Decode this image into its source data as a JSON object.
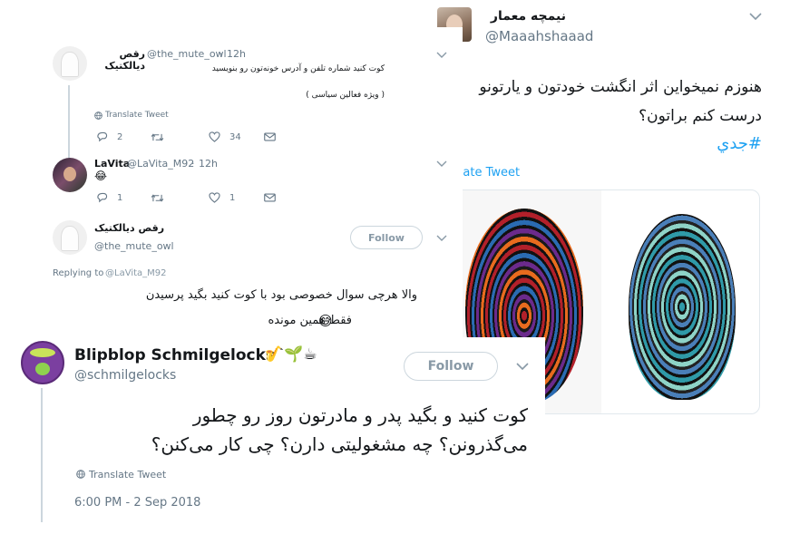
{
  "right_tweet": {
    "display_name": "نیمچه معمار",
    "handle": "@Maaahshaaad",
    "text_line1": "هنوزم نمیخواین اثر انگشت خودتون و یارتونو",
    "text_line2": "درست کنم براتون؟",
    "hashtag": "#جدي",
    "translate": "slate Tweet"
  },
  "reply1": {
    "display_name": "رقص دیالکتیک",
    "handle": "@the_mute_owl",
    "time": "12h",
    "text_line1": "کوت کنید شماره تلفن و آدرس خونه‌تون رو بنویسید",
    "text_line2": "( ویژه فعالین سیاسی )",
    "translate": "Translate Tweet",
    "reply_count": "2",
    "like_count": "34"
  },
  "reply2": {
    "display_name": "LaVita",
    "handle": "@LaVita_M92",
    "time": "12h",
    "emoji": "😂",
    "reply_count": "1",
    "like_count": "1"
  },
  "reply3": {
    "display_name": "رقص دیالکتیک",
    "handle": "@the_mute_owl",
    "follow": "Follow",
    "replying_label": "Replying to",
    "replying_handle": "@LaVita_M92",
    "text_line1": "والا هرچی سوال خصوصی بود با کوت کنید بگید پرسیدن",
    "text_line2": "فقط همین مونده",
    "emoji": "😅"
  },
  "main_tweet": {
    "display_name": "Blipblop Schmilgelocks",
    "name_emoji": "🎷🌱☕",
    "handle": "@schmilgelocks",
    "follow": "Follow",
    "text_line1": "کوت کنید و بگید پدر و مادرتون روز رو چطور",
    "text_line2": "می‌گذرونن؟ چه مشغولیتی دارن؟ چی کار می‌کنن؟",
    "translate": "Translate Tweet",
    "timestamp": "6:00 PM - 2 Sep 2018"
  },
  "colors": {
    "link": "#1da1f2",
    "muted": "#657786",
    "border": "#ccd6dd"
  }
}
